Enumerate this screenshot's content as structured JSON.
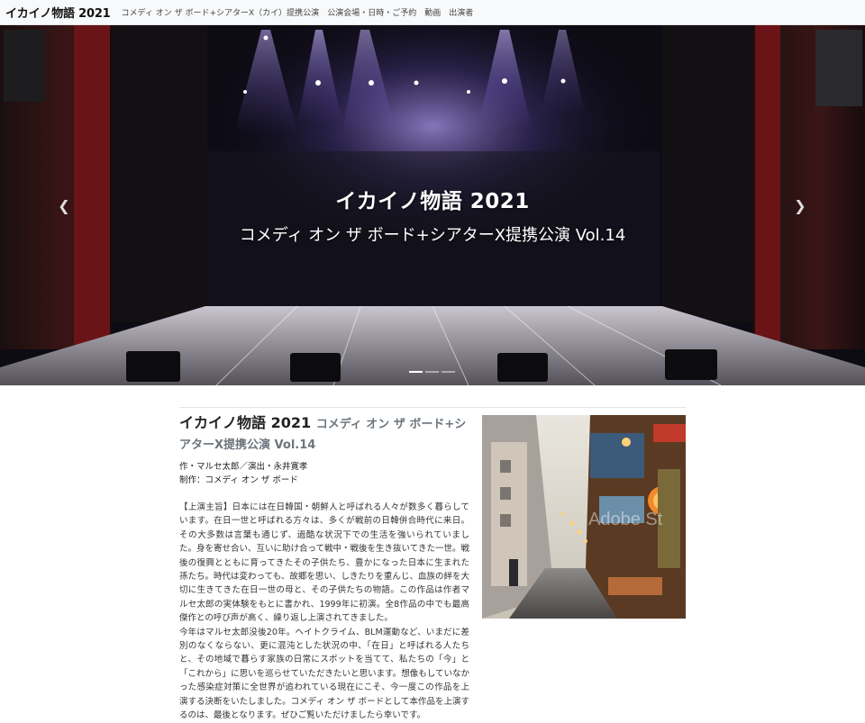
{
  "navbar": {
    "brand": "イカイノ物語 2021",
    "links": [
      "コメディ オン ザ ボード+シアターX（カイ）提携公演",
      "公演会場・日時・ご予約",
      "動画",
      "出演者"
    ]
  },
  "hero": {
    "title": "イカイノ物語 2021",
    "subtitle": "コメディ オン ザ ボード+シアターX提携公演 Vol.14",
    "prev_icon": "chevron-left-icon",
    "next_icon": "chevron-right-icon",
    "slides": 3,
    "active_slide": 1
  },
  "main": {
    "title": "イカイノ物語 2021",
    "subtitle": "コメディ オン ザ ボード+シアターX提携公演 Vol.14",
    "credit1": "作・マルセ太郎／演出・永井寛孝",
    "credit2": "制作：コメディ オン ザ ボード",
    "para1": "【上演主旨】日本には在日韓国・朝鮮人と呼ばれる人々が数多く暮らしています。在日一世と呼ばれる方々は、多くが戦前の日韓併合時代に来日。その大多数は言葉も通じず、過酷な状況下での生活を強いられていました。身を寄せ合い、互いに助け合って戦中・戦後を生き抜いてきた一世。戦後の復興とともに育ってきたその子供たち、豊かになった日本に生まれた孫たち。時代は変わっても、故郷を思い、しきたりを重んじ、血族の絆を大切に生きてきた在日一世の母と、その子供たちの物語。この作品は作者マルセ太郎の実体験をもとに書かれ、1999年に初演。全8作品の中でも最高傑作との呼び声が高く、繰り返し上演されてきました。",
    "para2": "今年はマルセ太郎没後20年。ヘイトクライム、BLM運動など、いまだに差別のなくならない、更に混沌とした状況の中、「在日」と呼ばれる人たちと、その地域で暮らす家族の日常にスポットを当てて、私たちの「今」と「これから」に思いを巡らせていただきたいと思います。想像もしていなかった感染症対策に全世界が追われている現在にこそ、今一度この作品を上演する決断をいたしました。コメディ オン ザ ボードとして本作品を上演するのは、最後となります。ぜひご覧いただけましたら幸いです。",
    "photo_watermark": "Adobe St"
  },
  "colors": {
    "navbar_bg": "#f8f9fa",
    "muted": "#6c757d",
    "stage_light": "#a98cff"
  }
}
